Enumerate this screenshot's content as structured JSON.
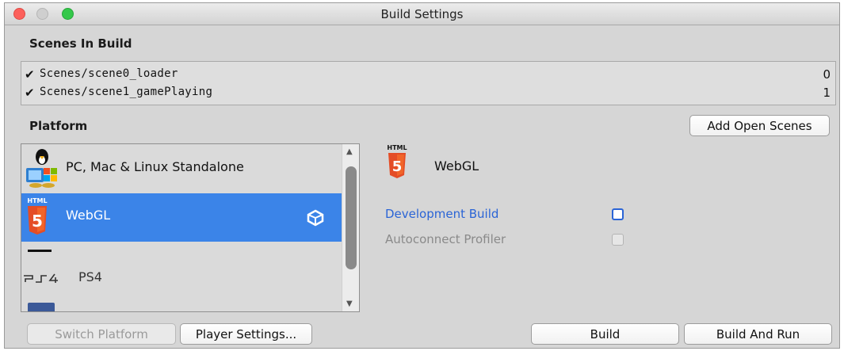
{
  "window": {
    "title": "Build Settings"
  },
  "scenes": {
    "heading": "Scenes In Build",
    "items": [
      {
        "path": "Scenes/scene0_loader",
        "index": "0",
        "checked": true
      },
      {
        "path": "Scenes/scene1_gamePlaying",
        "index": "1",
        "checked": true
      }
    ],
    "add_open_scenes_label": "Add Open Scenes"
  },
  "platform": {
    "heading": "Platform",
    "items": [
      {
        "label": "PC, Mac & Linux Standalone",
        "icon": "pc-mac-linux-icon"
      },
      {
        "label": "WebGL",
        "icon": "html5-icon",
        "selected": true
      },
      {
        "label": "PS4",
        "icon": "ps4-logo-icon"
      }
    ]
  },
  "details": {
    "title": "WebGL",
    "html_badge": "HTML",
    "development_build_label": "Development Build",
    "autoconnect_profiler_label": "Autoconnect Profiler"
  },
  "buttons": {
    "switch_platform": "Switch Platform",
    "player_settings": "Player Settings...",
    "build": "Build",
    "build_and_run": "Build And Run"
  },
  "colors": {
    "selection": "#3b84e8",
    "link_blue": "#2a64d6",
    "html5_orange": "#e44d26"
  }
}
